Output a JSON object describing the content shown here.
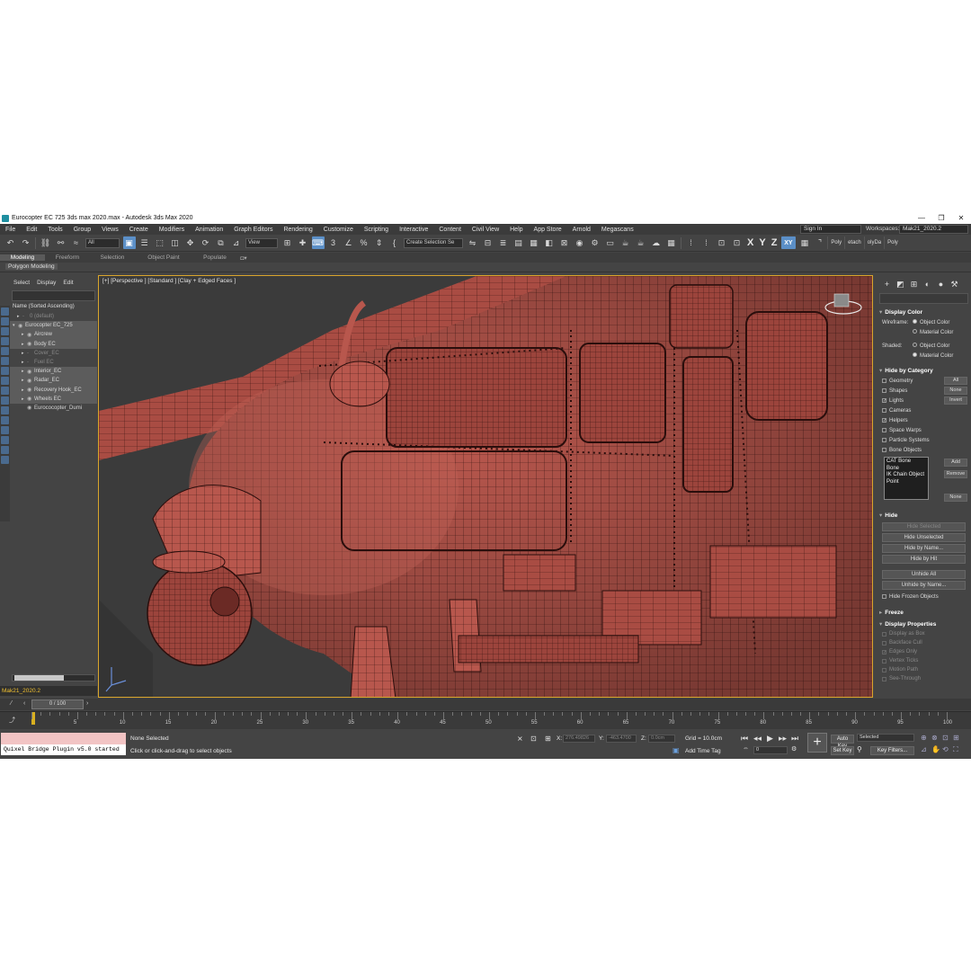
{
  "window": {
    "title": "Eurocopter EC 725 3ds max 2020.max - Autodesk 3ds Max 2020"
  },
  "menu": [
    "File",
    "Edit",
    "Tools",
    "Group",
    "Views",
    "Create",
    "Modifiers",
    "Animation",
    "Graph Editors",
    "Rendering",
    "Customize",
    "Scripting",
    "Interactive",
    "Content",
    "Civil View",
    "Help",
    "App Store",
    "Arnold",
    "Megascans"
  ],
  "account": {
    "sign_in": "Sign In",
    "workspaces_label": "Workspaces:",
    "workspace": "Mak21_2020.2"
  },
  "toolbar": {
    "filter": "All",
    "ref_coord": "View",
    "selection_set": "Create Selection Se",
    "axis_x": "X",
    "axis_y": "Y",
    "axis_z": "Z",
    "axis_xy": "XY",
    "tabs": [
      "Poly",
      "etach",
      "olyDa",
      "Poly"
    ]
  },
  "ribbon": {
    "tabs": [
      "Modeling",
      "Freeform",
      "Selection",
      "Object Paint",
      "Populate"
    ],
    "sub": "Polygon Modeling"
  },
  "explorer": {
    "tabs": [
      "Select",
      "Display",
      "Edit"
    ],
    "column_header": "Name (Sorted Ascending)",
    "items": [
      {
        "label": "0 (default)",
        "indent": 1,
        "arrow": "▸",
        "hidden": true
      },
      {
        "label": "Eurocopter EC_725",
        "indent": 0,
        "arrow": "▾",
        "selected": true
      },
      {
        "label": "Aircrew",
        "indent": 2,
        "arrow": "▸",
        "selected": true
      },
      {
        "label": "Body EC",
        "indent": 2,
        "arrow": "▸",
        "selected": true
      },
      {
        "label": "Cover_EC",
        "indent": 2,
        "arrow": "▸",
        "hidden": true
      },
      {
        "label": "Fuel EC",
        "indent": 2,
        "arrow": "▸",
        "hidden": true
      },
      {
        "label": "Interior_EC",
        "indent": 2,
        "arrow": "▸",
        "selected": true
      },
      {
        "label": "Radar_EC",
        "indent": 2,
        "arrow": "▸",
        "selected": true
      },
      {
        "label": "Recovery Hook_EC",
        "indent": 2,
        "arrow": "▸",
        "selected": true
      },
      {
        "label": "Wheels EC",
        "indent": 2,
        "arrow": "▸",
        "selected": true
      },
      {
        "label": "Eurococopter_Dumi",
        "indent": 2,
        "arrow": "",
        "selected": false
      }
    ],
    "layer": "Mak21_2020.2"
  },
  "viewport": {
    "label": "[+] [Perspective ] [Standard ] [Clay + Edged Faces ]"
  },
  "command_panel": {
    "display_color": {
      "title": "Display Color",
      "wireframe_label": "Wireframe:",
      "shaded_label": "Shaded:",
      "object_color": "Object Color",
      "material_color": "Material Color"
    },
    "hide_by_category": {
      "title": "Hide by Category",
      "categories": [
        "Geometry",
        "Shapes",
        "Lights",
        "Cameras",
        "Helpers",
        "Space Warps",
        "Particle Systems",
        "Bone Objects"
      ],
      "checked": [
        "Lights",
        "Helpers"
      ],
      "btn_all": "All",
      "btn_none": "None",
      "btn_invert": "Invert",
      "list": [
        "CAT Bone",
        "Bone",
        "IK Chain Object",
        "Point"
      ],
      "btn_add": "Add",
      "btn_remove": "Remove",
      "btn_none2": "None"
    },
    "hide": {
      "title": "Hide",
      "buttons": [
        "Hide Selected",
        "Hide Unselected",
        "Hide by Name...",
        "Hide by Hit",
        "Unhide All",
        "Unhide by Name..."
      ],
      "frozen": "Hide Frozen Objects"
    },
    "freeze": {
      "title": "Freeze"
    },
    "display_properties": {
      "title": "Display Properties",
      "items": [
        "Display as Box",
        "Backface Cull",
        "Edges Only",
        "Vertex Ticks",
        "Motion Path",
        "See-Through"
      ]
    }
  },
  "timeline": {
    "slider": "0 / 100",
    "ticks": [
      "5",
      "10",
      "15",
      "20",
      "25",
      "30",
      "35",
      "40",
      "45",
      "50",
      "55",
      "60",
      "65",
      "70",
      "75",
      "80",
      "85",
      "90",
      "95",
      "100"
    ]
  },
  "status": {
    "maxscript_output": "Quixel Bridge Plugin v5.0 started",
    "selection": "None Selected",
    "prompt": "Click or click-and-drag to select objects",
    "x_label": "X:",
    "x_value": "276.49826",
    "y_label": "Y:",
    "y_value": "-463.4700",
    "z_label": "Z:",
    "z_value": "0.0cm",
    "grid": "Grid = 10.0cm",
    "add_time_tag": "Add Time Tag",
    "auto_key": "Auto Key",
    "set_key": "Set Key",
    "key_mode": "Selected",
    "key_filters": "Key Filters...",
    "frame": "0"
  },
  "colors": {
    "model": "#b8574d",
    "wire": "#3a1512",
    "viewport_bg": "#3a3a3a",
    "accent": "#5b8fc7",
    "viewport_border": "#d9a52b"
  }
}
